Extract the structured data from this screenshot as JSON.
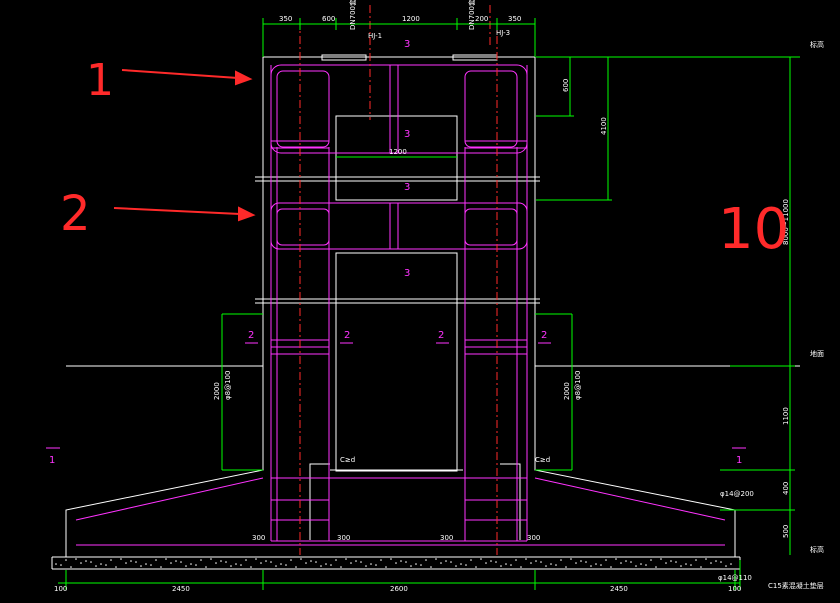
{
  "colors": {
    "background": "#000000",
    "outline": "#ffffff",
    "dimension": "#00ff00",
    "rebar": "#ff33ff",
    "axis": "#ff2a2a",
    "annotation": "#ff2a2a"
  },
  "top_dims": [
    "350",
    "600",
    "1200",
    "200",
    "350"
  ],
  "axis_labels": [
    "DN700套管",
    "DN700套管"
  ],
  "pipe_tags": [
    "HJ-1",
    "HJ-3"
  ],
  "section_marks": {
    "center": "3",
    "side": "2",
    "outer": "1"
  },
  "right_dims": {
    "top": "600",
    "upper": "4100",
    "total": "8000~11000",
    "mid": "1100",
    "low": "400",
    "base": "500"
  },
  "left_dim": {
    "value": "2000",
    "sub": "φ8@100"
  },
  "opening_width": "1200",
  "inner_dims": [
    "C≥d",
    "C≥d"
  ],
  "base_dims": [
    "300",
    "300",
    "300",
    "300"
  ],
  "bottom_dims": [
    "100",
    "2450",
    "2600",
    "2450",
    "100"
  ],
  "rebar_note": "φ14@200",
  "rebar_note2": "φ14@110",
  "concrete_label": "C15素混凝土垫层",
  "level_marks": [
    "标高",
    "地面",
    "标高"
  ],
  "annotations": {
    "one": "1",
    "two": "2",
    "ten": "10"
  }
}
